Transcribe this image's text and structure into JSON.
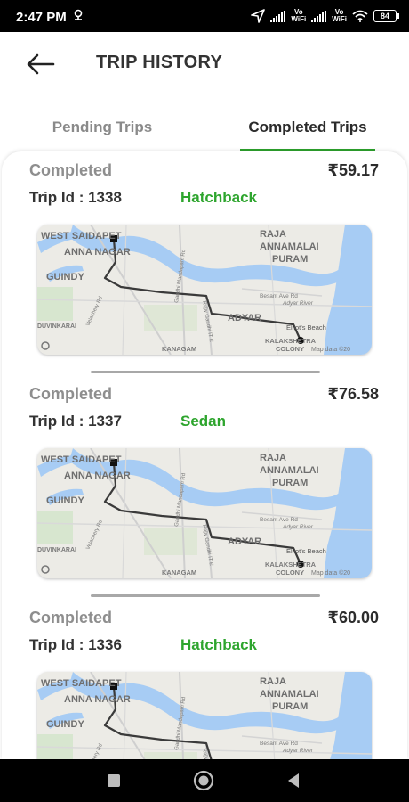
{
  "status_bar": {
    "time": "2:47 PM",
    "vowifi_1": "Vo\nWiFi",
    "vowifi_2": "Vo\nWiFi",
    "battery": "84",
    "icons": [
      "location-icon",
      "navigation-arrow-icon",
      "signal-icon",
      "wifi-icon",
      "battery-icon"
    ]
  },
  "header": {
    "title": "TRIP HISTORY",
    "back_icon": "arrow-left-icon"
  },
  "tabs": [
    {
      "label": "Pending Trips",
      "active": false
    },
    {
      "label": "Completed Trips",
      "active": true
    }
  ],
  "colors": {
    "accent": "#2ca02c",
    "vehicle_text": "#2ea52e",
    "water": "#a7ccf4",
    "route": "#3a3a3a"
  },
  "trips": [
    {
      "status": "Completed",
      "fare": "₹59.17",
      "trip_id": "Trip Id : 1338",
      "vehicle": "Hatchback"
    },
    {
      "status": "Completed",
      "fare": "₹76.58",
      "trip_id": "Trip Id : 1337",
      "vehicle": "Sedan"
    },
    {
      "status": "Completed",
      "fare": "₹60.00",
      "trip_id": "Trip Id : 1336",
      "vehicle": "Hatchback"
    }
  ],
  "map_labels": {
    "west_saidapet": "WEST SAIDAPET",
    "anna_nagar": "ANNA NAGAR",
    "raja": "RAJA",
    "annamalai": "ANNAMALAI",
    "puram": "PURAM",
    "guindy": "GUINDY",
    "adyar": "ADYAR",
    "adyar_river": "Adyar River",
    "besant": "Besant Ave Rd",
    "velachery": "Velachery Rd",
    "gandhi": "Gandhi Mandapam Rd",
    "rajiv": "Rajiv Gandhi IT E",
    "elliots": "Elliot's Beach",
    "duvinkarai": "DUVINKARAI",
    "kalakshetra": "KALAKSHETRA",
    "colony": "COLONY",
    "kanagam": "KANAGAM",
    "map_data": "Map data ©20"
  },
  "nav_bar": {
    "icons": [
      "recents-square-icon",
      "home-circle-icon",
      "back-triangle-icon"
    ]
  }
}
